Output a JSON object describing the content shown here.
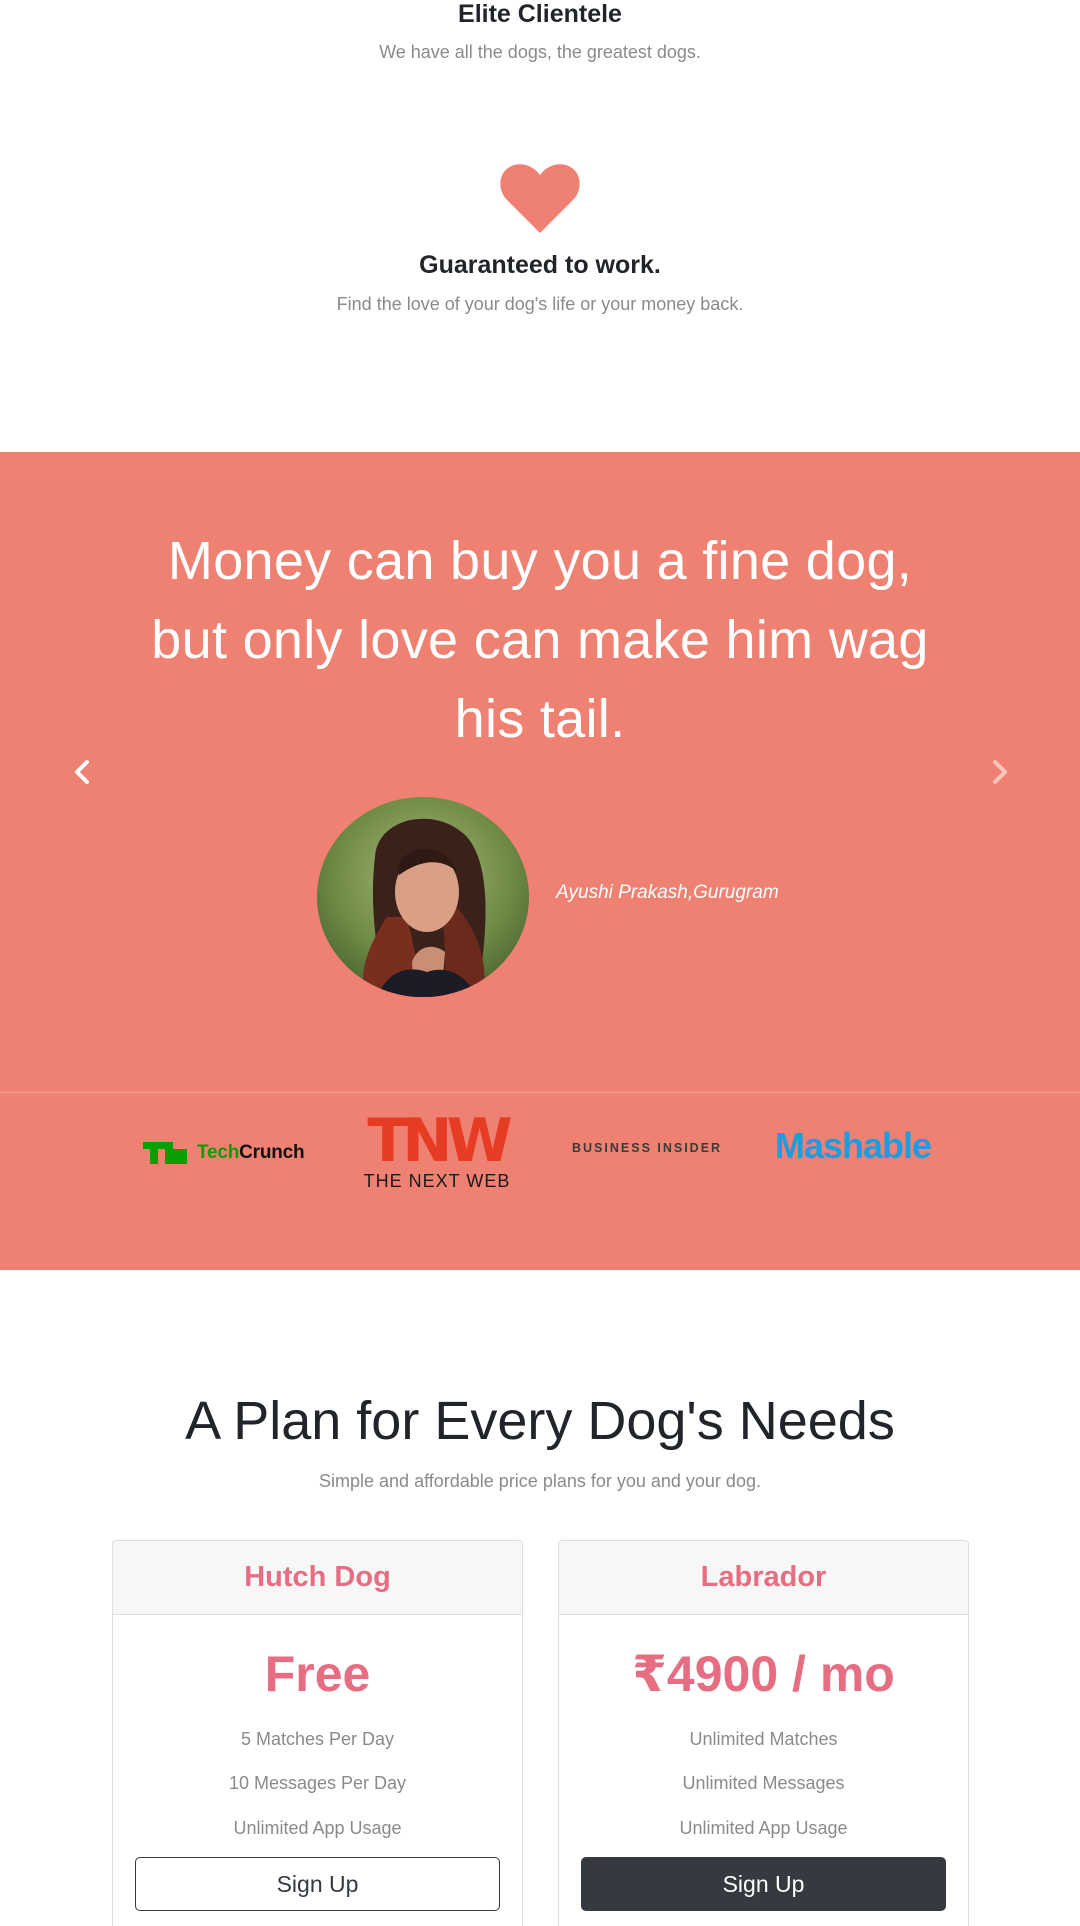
{
  "features": {
    "item1": {
      "title": "Elite Clientele",
      "text": "We have all the dogs, the greatest dogs."
    },
    "item2": {
      "icon": "heart-icon",
      "title": "Guaranteed to work.",
      "text": "Find the love of your dog's life or your money back."
    }
  },
  "colors": {
    "accent": "#ef8172",
    "price": "#e66d82",
    "dark_button": "#343a40"
  },
  "testimonial": {
    "quote": "Money can buy you a fine dog, but only love can make him wag his tail.",
    "author": "Ayushi Prakash,Gurugram",
    "prev_icon": "chevron-left-icon",
    "next_icon": "chevron-right-icon"
  },
  "press": {
    "techcrunch": {
      "tech": "Tech",
      "crunch": "Crunch"
    },
    "tnw": {
      "letters": "TNW",
      "sub": "THE NEXT WEB"
    },
    "business_insider": "BUSINESS INSIDER",
    "mashable": "Mashable"
  },
  "pricing": {
    "title": "A Plan for Every Dog's Needs",
    "subtitle": "Simple and affordable price plans for you and your dog.",
    "plans": [
      {
        "name": "Hutch Dog",
        "price": "Free",
        "features": [
          "5 Matches Per Day",
          "10 Messages Per Day",
          "Unlimited App Usage"
        ],
        "button": "Sign Up"
      },
      {
        "name": "Labrador",
        "price": "₹4900 / mo",
        "features": [
          "Unlimited Matches",
          "Unlimited Messages",
          "Unlimited App Usage"
        ],
        "button": "Sign Up"
      }
    ]
  }
}
